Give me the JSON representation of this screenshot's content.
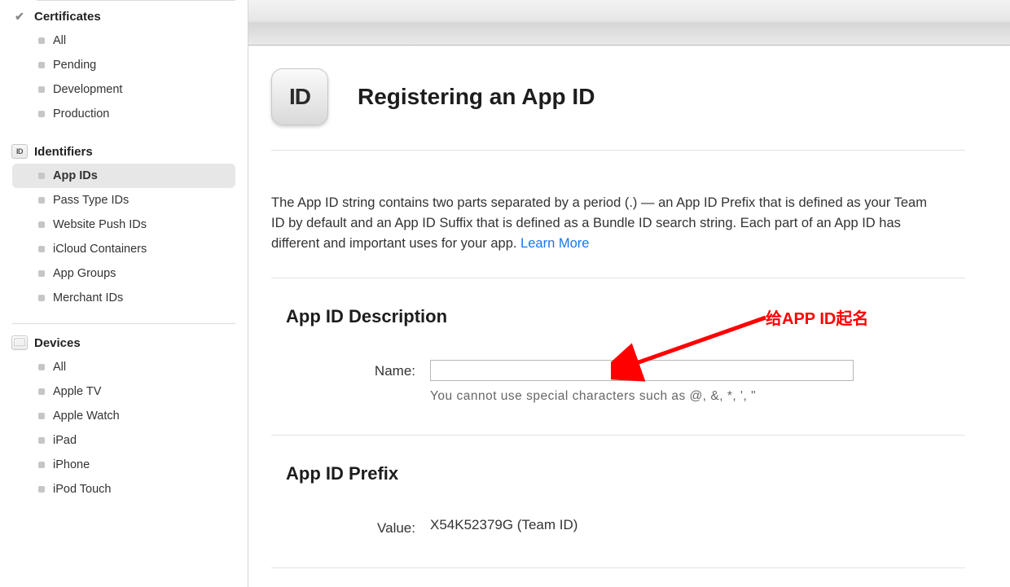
{
  "sidebar": {
    "certificates": {
      "header": "Certificates",
      "items": [
        {
          "label": "All"
        },
        {
          "label": "Pending"
        },
        {
          "label": "Development"
        },
        {
          "label": "Production"
        }
      ]
    },
    "identifiers": {
      "header": "Identifiers",
      "items": [
        {
          "label": "App IDs",
          "active": true
        },
        {
          "label": "Pass Type IDs"
        },
        {
          "label": "Website Push IDs"
        },
        {
          "label": "iCloud Containers"
        },
        {
          "label": "App Groups"
        },
        {
          "label": "Merchant IDs"
        }
      ]
    },
    "devices": {
      "header": "Devices",
      "items": [
        {
          "label": "All"
        },
        {
          "label": "Apple TV"
        },
        {
          "label": "Apple Watch"
        },
        {
          "label": "iPad"
        },
        {
          "label": "iPhone"
        },
        {
          "label": "iPod Touch"
        }
      ]
    }
  },
  "main": {
    "badge_text": "ID",
    "title": "Registering an App ID",
    "intro_before_link": "The App ID string contains two parts separated by a period (.) — an App ID Prefix that is defined as your Team ID by default and an App ID Suffix that is defined as a Bundle ID search string. Each part of an App ID has different and important uses for your app. ",
    "learn_more": "Learn More",
    "description": {
      "heading": "App ID Description",
      "name_label": "Name:",
      "name_value": "",
      "helper": "You cannot use special characters such as @, &, *, ', \""
    },
    "prefix": {
      "heading": "App ID Prefix",
      "value_label": "Value:",
      "value": "X54K52379G (Team ID)"
    }
  },
  "annotation": {
    "text": "给APP ID起名"
  }
}
